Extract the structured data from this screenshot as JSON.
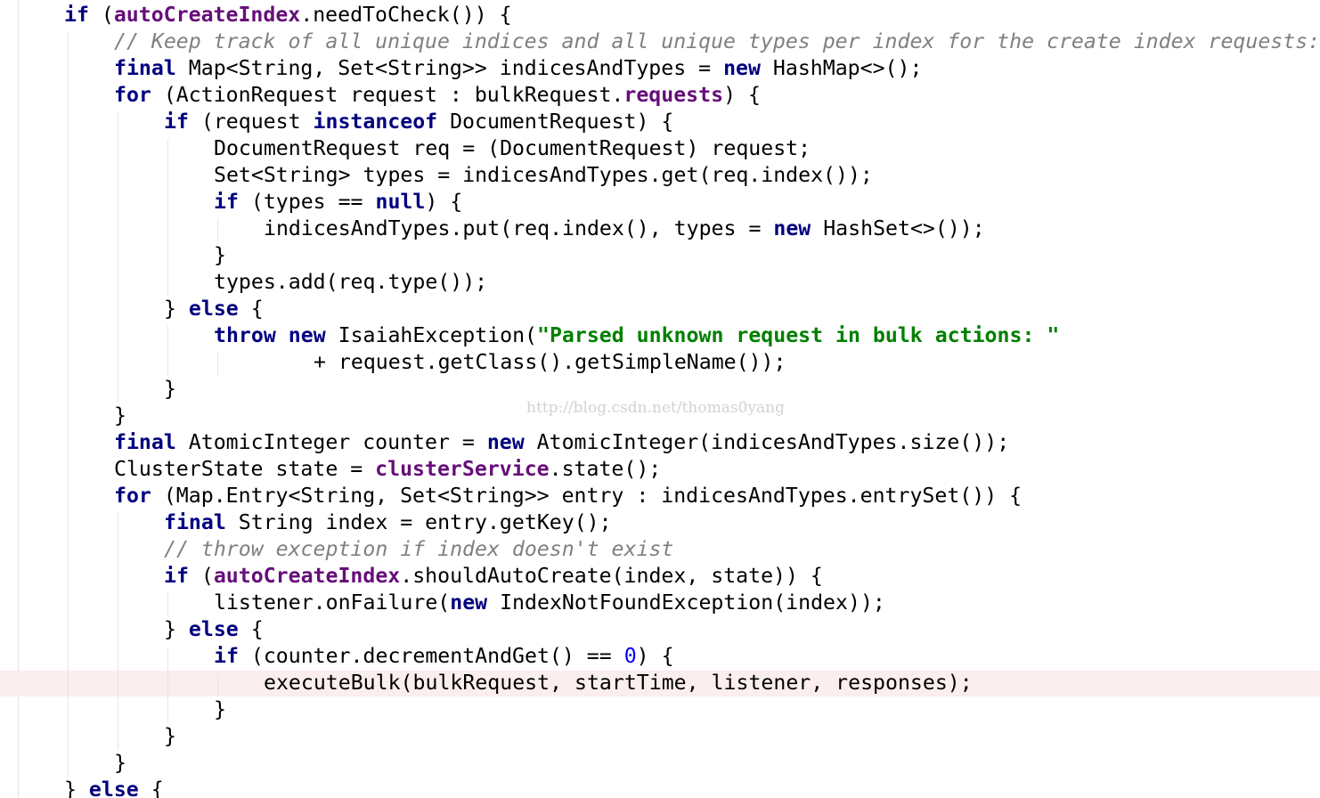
{
  "editor": {
    "theme_colors": {
      "keyword": "#000080",
      "field": "#660e7a",
      "string": "#008000",
      "comment": "#808080",
      "number": "#0000ff",
      "current_line_background": "#fbeeee"
    },
    "current_line_index": 25,
    "lines": [
      [
        {
          "t": "if",
          "c": "kw"
        },
        {
          "t": " ("
        },
        {
          "t": "autoCreateIndex",
          "c": "fld"
        },
        {
          "t": ".needToCheck()) {"
        }
      ],
      [
        {
          "t": "// Keep track of all unique indices and all unique types per index for the create index requests:",
          "c": "cmt"
        }
      ],
      [
        {
          "t": "final",
          "c": "kw"
        },
        {
          "t": " Map<String, Set<String>> indicesAndTypes = "
        },
        {
          "t": "new",
          "c": "kw"
        },
        {
          "t": " HashMap<>();"
        }
      ],
      [
        {
          "t": "for",
          "c": "kw"
        },
        {
          "t": " (ActionRequest request : bulkRequest."
        },
        {
          "t": "requests",
          "c": "fld"
        },
        {
          "t": ") {"
        }
      ],
      [
        {
          "t": "if",
          "c": "kw"
        },
        {
          "t": " (request "
        },
        {
          "t": "instanceof",
          "c": "kw"
        },
        {
          "t": " DocumentRequest) {"
        }
      ],
      [
        {
          "t": "DocumentRequest req = (DocumentRequest) request;"
        }
      ],
      [
        {
          "t": "Set<String> types = indicesAndTypes.get(req.index());"
        }
      ],
      [
        {
          "t": "if",
          "c": "kw"
        },
        {
          "t": " (types == "
        },
        {
          "t": "null",
          "c": "kw"
        },
        {
          "t": ") {"
        }
      ],
      [
        {
          "t": "indicesAndTypes.put(req.index(), types = "
        },
        {
          "t": "new",
          "c": "kw"
        },
        {
          "t": " HashSet<>());"
        }
      ],
      [
        {
          "t": "}"
        }
      ],
      [
        {
          "t": "types.add(req.type());"
        }
      ],
      [
        {
          "t": "} "
        },
        {
          "t": "else",
          "c": "kw"
        },
        {
          "t": " {"
        }
      ],
      [
        {
          "t": "throw",
          "c": "kw"
        },
        {
          "t": " "
        },
        {
          "t": "new",
          "c": "kw"
        },
        {
          "t": " IsaiahException("
        },
        {
          "t": "\"Parsed unknown request in bulk actions: \"",
          "c": "str"
        }
      ],
      [
        {
          "t": "+ request.getClass().getSimpleName());"
        }
      ],
      [
        {
          "t": "}"
        }
      ],
      [
        {
          "t": "}"
        }
      ],
      [
        {
          "t": "final",
          "c": "kw"
        },
        {
          "t": " AtomicInteger counter = "
        },
        {
          "t": "new",
          "c": "kw"
        },
        {
          "t": " AtomicInteger(indicesAndTypes.size());"
        }
      ],
      [
        {
          "t": "ClusterState state = "
        },
        {
          "t": "clusterService",
          "c": "fld"
        },
        {
          "t": ".state();"
        }
      ],
      [
        {
          "t": "for",
          "c": "kw"
        },
        {
          "t": " (Map.Entry<String, Set<String>> entry : indicesAndTypes.entrySet()) {"
        }
      ],
      [
        {
          "t": "final",
          "c": "kw"
        },
        {
          "t": " String index = entry.getKey();"
        }
      ],
      [
        {
          "t": "// throw exception if index doesn't exist",
          "c": "cmt"
        }
      ],
      [
        {
          "t": "if",
          "c": "kw"
        },
        {
          "t": " ("
        },
        {
          "t": "autoCreateIndex",
          "c": "fld"
        },
        {
          "t": ".shouldAutoCreate(index, state)) {"
        }
      ],
      [
        {
          "t": "listener.onFailure("
        },
        {
          "t": "new",
          "c": "kw"
        },
        {
          "t": " IndexNotFoundException(index));"
        }
      ],
      [
        {
          "t": "} "
        },
        {
          "t": "else",
          "c": "kw"
        },
        {
          "t": " {"
        }
      ],
      [
        {
          "t": "if",
          "c": "kw"
        },
        {
          "t": " (counter.decrementAndGet() == "
        },
        {
          "t": "0",
          "c": "num"
        },
        {
          "t": ") {"
        }
      ],
      [
        {
          "t": "executeBulk(bulkRequest, startTime, listener, responses);"
        }
      ],
      [
        {
          "t": "}"
        }
      ],
      [
        {
          "t": "}"
        }
      ],
      [
        {
          "t": "}"
        }
      ],
      [
        {
          "t": "} "
        },
        {
          "t": "else",
          "c": "kw"
        },
        {
          "t": " {"
        }
      ]
    ]
  },
  "watermark": "http://blog.csdn.net/thomas0yang"
}
